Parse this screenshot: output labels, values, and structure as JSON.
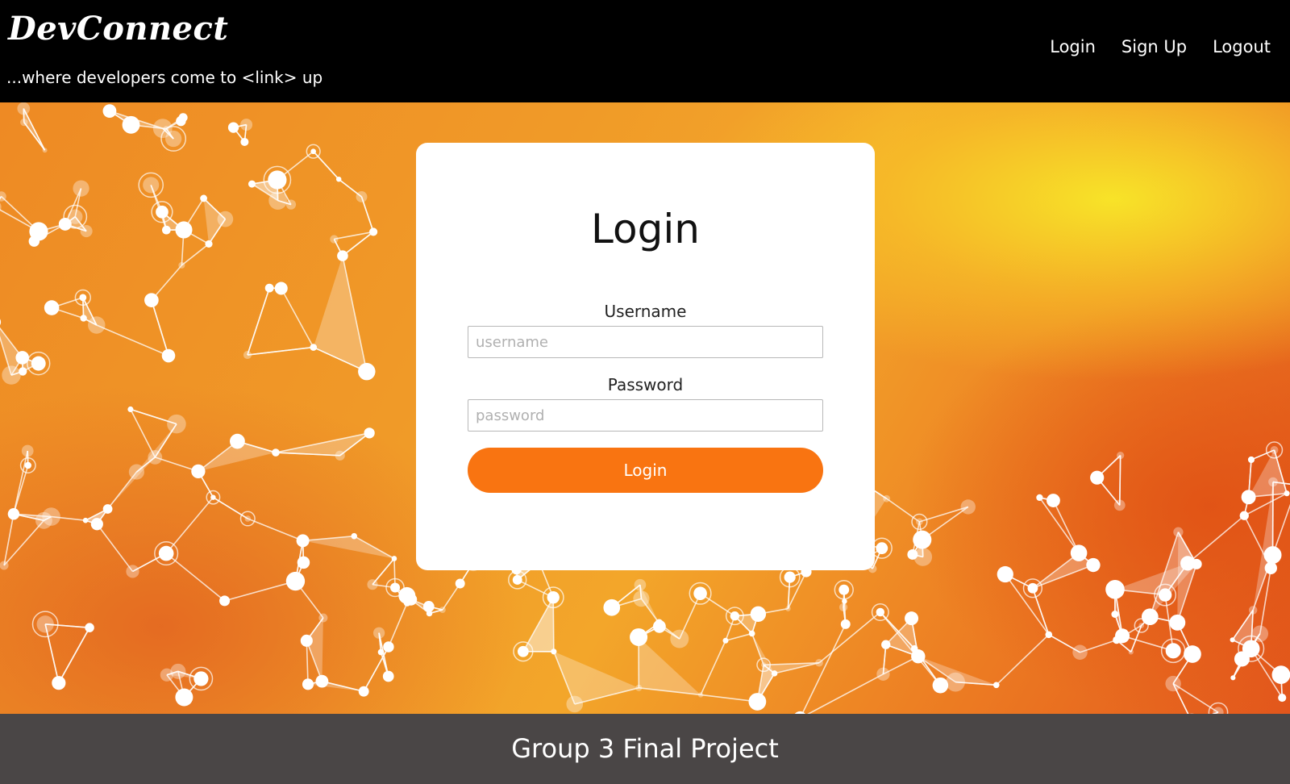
{
  "header": {
    "brand": "DevConnect",
    "tagline": "...where developers come to <link> up",
    "nav": {
      "login": "Login",
      "signup": "Sign Up",
      "logout": "Logout"
    }
  },
  "login_card": {
    "title": "Login",
    "username_label": "Username",
    "username_placeholder": "username",
    "username_value": "",
    "password_label": "Password",
    "password_placeholder": "password",
    "password_value": "",
    "submit_label": "Login"
  },
  "footer": {
    "text": "Group 3 Final Project"
  },
  "colors": {
    "header_bg": "#000000",
    "accent": "#f97411",
    "footer_bg": "#4a4646",
    "hero_yellow": "#f8e828",
    "hero_orange": "#ee8a24"
  },
  "decorations": {
    "hero_background": "network-nodes-pattern"
  }
}
